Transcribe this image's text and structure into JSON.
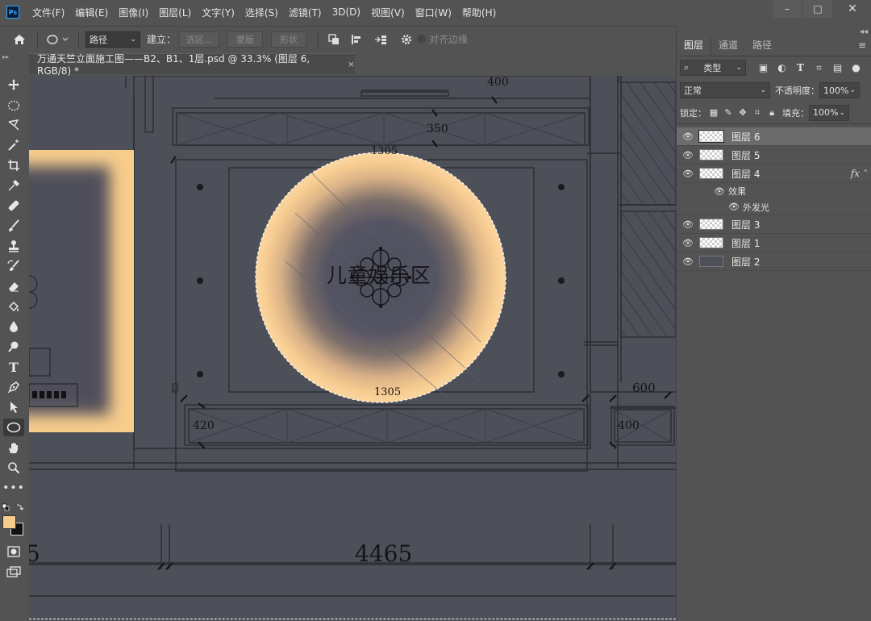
{
  "app": {
    "logo": "Ps"
  },
  "menu": [
    "文件(F)",
    "编辑(E)",
    "图像(I)",
    "图层(L)",
    "文字(Y)",
    "选择(S)",
    "滤镜(T)",
    "3D(D)",
    "视图(V)",
    "窗口(W)",
    "帮助(H)"
  ],
  "window_controls": {
    "minimize": "–",
    "restore": "□",
    "close": "✕"
  },
  "options": {
    "mode_select": "路径",
    "make_label": "建立：",
    "selection_btn": "选区...",
    "mask_btn": "蒙版",
    "shape_btn": "形状",
    "align_edges": "对齐边缘"
  },
  "document": {
    "tab_title": "万通天竺立面施工图——B2、B1、1层.psd @ 33.3% (图层 6, RGB/8) *",
    "close": "×"
  },
  "drawing": {
    "room_label": "儿童娱乐区",
    "dims": [
      "400",
      "350",
      "1305",
      "1305",
      "600",
      "420",
      "400",
      "4465",
      "5"
    ]
  },
  "colors": {
    "foreground": "#f8cd8c",
    "background": "#111111",
    "glow": "#f8cd8c",
    "canvas": "#4d4f59"
  },
  "layers_panel": {
    "tabs": [
      "图层",
      "通道",
      "路径"
    ],
    "filter_type": "类型",
    "blend_mode": "正常",
    "opacity_label": "不透明度：",
    "opacity_value": "100%",
    "lock_label": "锁定：",
    "fill_label": "填充：",
    "fill_value": "100%",
    "effects_label": "效果",
    "outer_glow_label": "外发光",
    "fx_label": "fx",
    "layers": [
      {
        "name": "图层 6",
        "selected": true
      },
      {
        "name": "图层 5",
        "selected": false
      },
      {
        "name": "图层 4",
        "selected": false,
        "has_fx": true
      },
      {
        "name": "图层 3",
        "selected": false
      },
      {
        "name": "图层 1",
        "selected": false
      },
      {
        "name": "图层 2",
        "selected": false
      }
    ]
  }
}
